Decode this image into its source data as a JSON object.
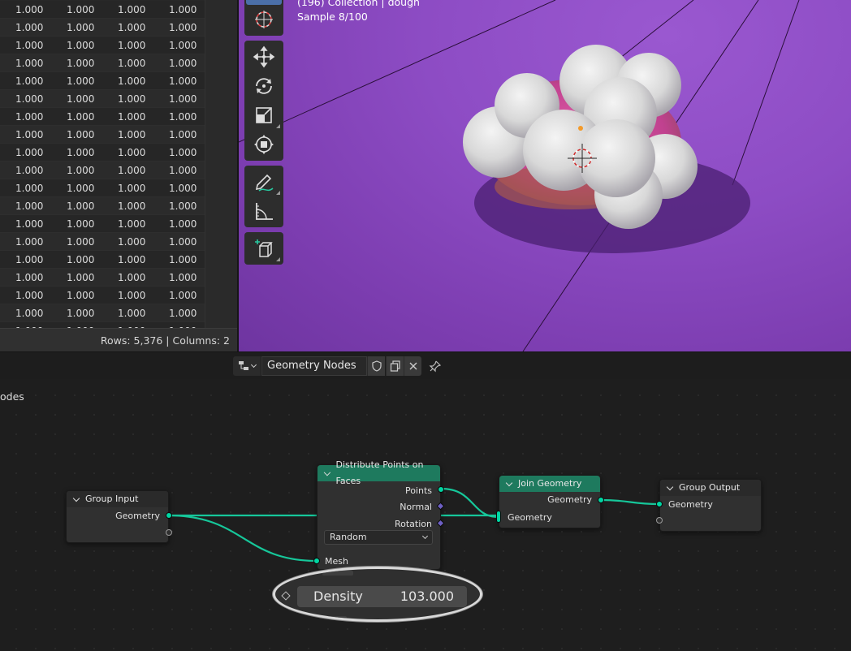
{
  "spreadsheet": {
    "rows": [
      [
        "1.000",
        "1.000",
        "1.000",
        "1.000"
      ],
      [
        "1.000",
        "1.000",
        "1.000",
        "1.000"
      ],
      [
        "1.000",
        "1.000",
        "1.000",
        "1.000"
      ],
      [
        "1.000",
        "1.000",
        "1.000",
        "1.000"
      ],
      [
        "1.000",
        "1.000",
        "1.000",
        "1.000"
      ],
      [
        "1.000",
        "1.000",
        "1.000",
        "1.000"
      ],
      [
        "1.000",
        "1.000",
        "1.000",
        "1.000"
      ],
      [
        "1.000",
        "1.000",
        "1.000",
        "1.000"
      ],
      [
        "1.000",
        "1.000",
        "1.000",
        "1.000"
      ],
      [
        "1.000",
        "1.000",
        "1.000",
        "1.000"
      ],
      [
        "1.000",
        "1.000",
        "1.000",
        "1.000"
      ],
      [
        "1.000",
        "1.000",
        "1.000",
        "1.000"
      ],
      [
        "1.000",
        "1.000",
        "1.000",
        "1.000"
      ],
      [
        "1.000",
        "1.000",
        "1.000",
        "1.000"
      ],
      [
        "1.000",
        "1.000",
        "1.000",
        "1.000"
      ],
      [
        "1.000",
        "1.000",
        "1.000",
        "1.000"
      ],
      [
        "1.000",
        "1.000",
        "1.000",
        "1.000"
      ],
      [
        "1.000",
        "1.000",
        "1.000",
        "1.000"
      ],
      [
        "1.000",
        "1.000",
        "1.000",
        "1.000"
      ]
    ],
    "status": "Rows: 5,376   |   Columns: 2"
  },
  "viewport": {
    "info_line": "(196) Collection | dough",
    "sample": "Sample 8/100",
    "background_color": "#8d4cc4"
  },
  "toolbar": {
    "tools": [
      "cursor-icon",
      "move-icon",
      "rotate-icon",
      "scale-icon",
      "transform-icon",
      "annotate-icon",
      "measure-icon",
      "add-cube-icon"
    ]
  },
  "node_header": {
    "tree_name": "Geometry Nodes"
  },
  "editor": {
    "breadcrumb_tail": "odes"
  },
  "nodes": {
    "group_input": {
      "title": "Group Input",
      "out_geometry": "Geometry"
    },
    "distribute": {
      "title": "Distribute Points on Faces",
      "out_points": "Points",
      "out_normal": "Normal",
      "out_rotation": "Rotation",
      "mode": "Random",
      "in_mesh": "Mesh"
    },
    "join": {
      "title": "Join Geometry",
      "out_geometry": "Geometry",
      "in_geometry": "Geometry"
    },
    "group_output": {
      "title": "Group Output",
      "in_geometry": "Geometry"
    }
  },
  "zoom": {
    "density_label": "Density",
    "density_value": "103.000"
  },
  "colors": {
    "geometry_socket": "#00d6a3",
    "vector_socket": "#6d5fc4",
    "node_header_green": "#1e7a5e"
  }
}
